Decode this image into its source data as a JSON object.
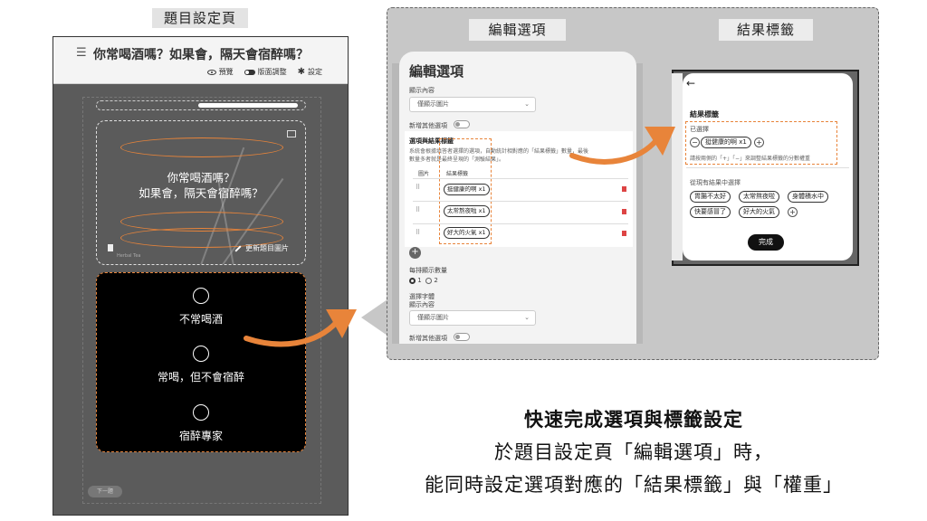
{
  "left": {
    "label": "題目設定頁",
    "header": {
      "title": "你常喝酒嗎？如果會，隔天會宿醉嗎？",
      "preview": "預覽",
      "layout_adjust": "版面調整",
      "settings": "設定"
    },
    "image_card": {
      "question_line1": "你常喝酒嗎？",
      "question_line2": "如果會，隔天會宿醉嗎？",
      "brand": "Herbal Tea",
      "update_image": "更新題目圖片"
    },
    "options": [
      "不常喝酒",
      "常喝，但不會宿醉",
      "宿醉專家"
    ],
    "next_button": "下一題"
  },
  "edit_panel": {
    "label": "編輯選項",
    "title": "編輯選項",
    "display_content_label": "顯示內容",
    "display_select": "僅顯示圖片",
    "add_other_option": "新增其他選項",
    "relation_title": "選項與結果標籤",
    "relation_desc_1": "系統會根據填答者選擇的選項，自動統計相對應的「結果標籤」數量，最後",
    "relation_desc_2": "數量多者就是最終呈現的「測驗結果」。",
    "col_image": "圖片",
    "col_tag": "結果標籤",
    "rows": [
      "挺健康的啊 x1",
      "太常熬夜啦 x1",
      "好大的火氣 x1"
    ],
    "per_row_count": "每排顯示數量",
    "per_row_options": [
      "1",
      "2"
    ],
    "font_label": "選擇字體",
    "display_content_label2": "顯示內容",
    "display_select2": "僅顯示圖片",
    "add_other_option2": "新增其他選項"
  },
  "tag_panel": {
    "label": "結果標籤",
    "heading": "結果標籤",
    "selected_label": "已選擇",
    "selected_chip": "挺健康的啊 x1",
    "hint": "請按兩側的「+」「−」來調整結果標籤的分數權重",
    "choose_label": "從現有結果中選擇",
    "choices": [
      "胃腸不太好",
      "太常熬夜啦",
      "身體積水中",
      "快要感冒了",
      "好大的火氣"
    ],
    "done": "完成"
  },
  "caption": {
    "line1": "快速完成選項與標籤設定",
    "line2": "於題目設定頁「編輯選項」時，",
    "line3": "能同時設定選項對應的「結果標籤」與「權重」"
  },
  "colors": {
    "accent_orange": "#e8843a",
    "dark_panel": "#5b5b5b",
    "gray_area": "#c7c7c7"
  }
}
